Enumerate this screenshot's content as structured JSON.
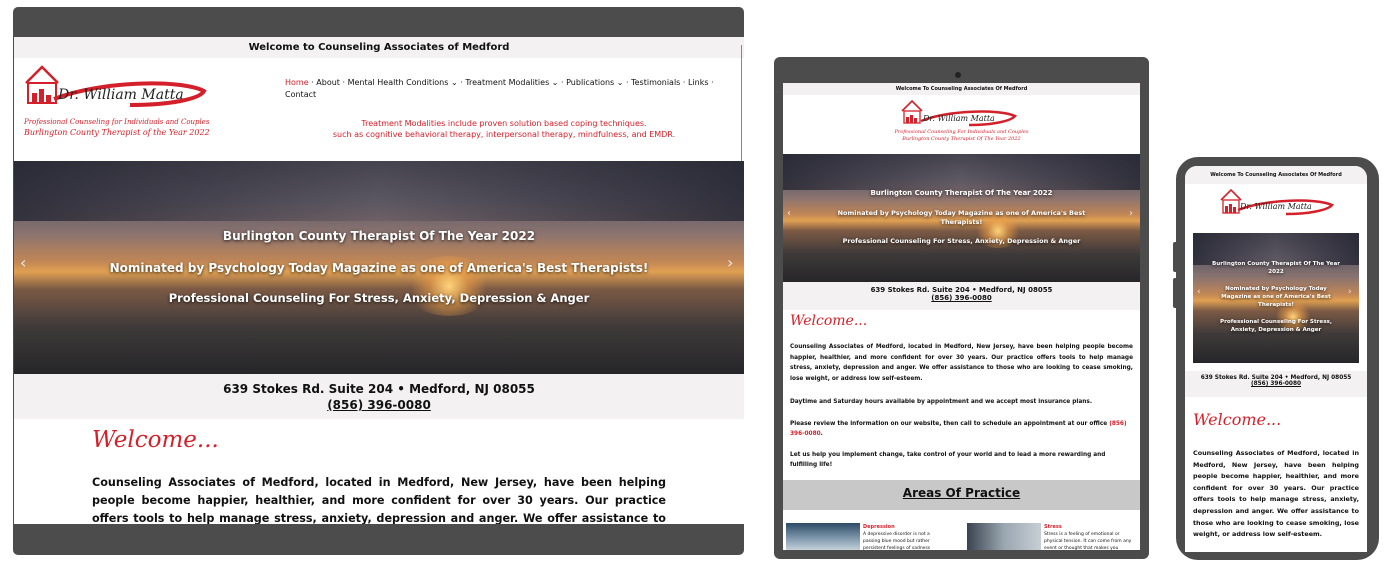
{
  "site": {
    "topbar_desktop": "Welcome to Counseling Associates of Medford",
    "topbar_small": "Welcome To Counseling Associates Of Medford",
    "logo_text": "Dr. William Matta",
    "tagline1": "Professional Counseling for Individuals and Couples",
    "tagline2": "Burlington County Therapist of the Year 2022",
    "tagline1_tablet": "Professional Counseling For Individuals and Couples",
    "tagline2_tablet": "Burlington County Therapist Of The Year 2022",
    "modalities_line1": "Treatment Modalities include proven solution based coping techniques.",
    "modalities_line2": "such as cognitive behavioral therapy, interpersonal therapy, mindfulness, and EMDR.",
    "nav": [
      {
        "label": "Home"
      },
      {
        "label": "About"
      },
      {
        "label": "Mental Health Conditions"
      },
      {
        "label": "Treatment Modalities"
      },
      {
        "label": "Publications"
      },
      {
        "label": "Testimonials"
      },
      {
        "label": "Links"
      },
      {
        "label": "Contact"
      }
    ],
    "hero": {
      "line1": "Burlington County Therapist Of The Year 2022",
      "line2": "Nominated by Psychology Today Magazine as one of America's Best Therapists!",
      "line3": "Professional Counseling For Stress, Anxiety, Depression & Anger"
    },
    "address": "639 Stokes Rd. Suite 204 • Medford, NJ 08055",
    "phone": "(856) 396-0080",
    "welcome_heading": "Welcome...",
    "welcome_p1": "Counseling Associates of Medford, located in Medford, New Jersey, have been helping people become happier, healthier, and more confident for over 30 years. Our practice offers tools to help manage stress, anxiety, depression and anger. We offer assistance to those who are looking to cease smoking, lose weight, or address low self-esteem.",
    "welcome_p2": "Daytime and Saturday hours available by appointment and we accept most insurance plans.",
    "welcome_p3_pre": "Please review the information on our website, then call to schedule an appointment at our office ",
    "welcome_p3_phone": "(856) 396-0080",
    "welcome_p4": "Let us help you implement change, take control of your world and to lead a more rewarding and fulfilling life!",
    "areas_heading": "Areas Of Practice",
    "area_depression_title": "Depression",
    "area_depression_text": "A depressive disorder is not a passing blue mood but rather persistent feelings of sadness and",
    "area_stress_title": "Stress",
    "area_stress_text": "Stress is a feeling of emotional or physical tension. It can come from any event or thought that makes you"
  },
  "colors": {
    "brand_red": "#d4202a",
    "frame": "#4c4c4c",
    "topbar": "#f3f1f1"
  }
}
